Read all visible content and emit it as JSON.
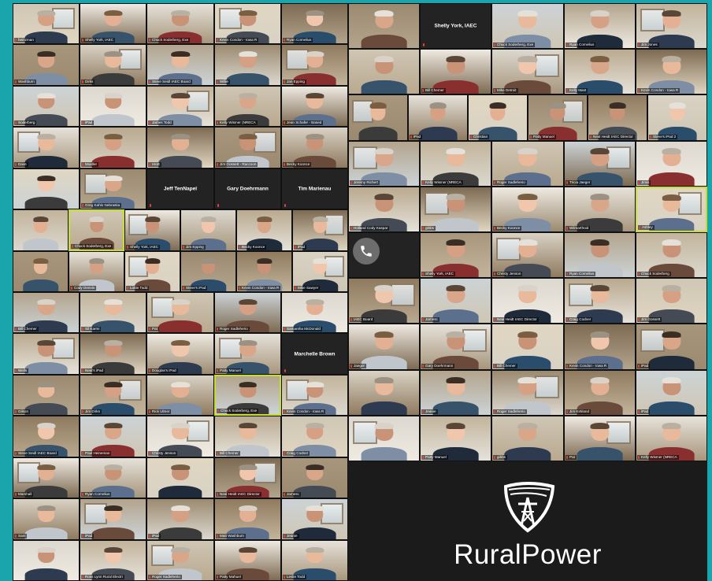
{
  "left_grid": {
    "names": [
      [
        "heinzman",
        "Shelly York, IAEC",
        "Chuck Soderberg, Exe",
        "Kevin Condon - Iowa R",
        "Ryan Cornelius"
      ],
      [
        "Washburn",
        "Dirks",
        "Steve Seidl IAEC Board",
        "Willie",
        "Jan Epping"
      ],
      [
        "Soderberg",
        "iPad",
        "James Todd",
        "Kelly Wismer (NRECA",
        "Jean Schafer - Based"
      ],
      [
        "Dave",
        "Moeller",
        "Hirdt",
        "Jim Gossett - Raccoon",
        "Becky Koonce"
      ],
      [
        "",
        "Greg Kahlo Nebraska",
        "Jeff TenNapel",
        "Gary Doehrmann",
        "Tim Marienau"
      ],
      [
        "",
        "Chuck Soderberg, Exe",
        "Shelly York, IAEC",
        "Jim Epping",
        "Becky Koonce",
        "iPad"
      ],
      [
        "",
        "Cody Dennis",
        "Lottie Todd",
        "Steve's iPad",
        "Kevin Condon - Iowa R",
        "Mike Sawyer"
      ],
      [
        "Bill Chemer",
        "Sil Karmi",
        "Pat",
        "Roger Sadleherio",
        "Samantha McDonald"
      ],
      [
        "Wells",
        "Neal's iPad",
        "Douglas's iPad",
        "Patty Manuel",
        "Marchelle Brown"
      ],
      [
        "Gilson",
        "Jim Dirks",
        "Rick Ulmer",
        "Chuck Soderberg, Exe",
        "Kevin Condon - Iowa R"
      ],
      [
        "Steve Seidl IAEC Board",
        "Paul Heineman",
        "Christy Jenson",
        "Bill Chemer",
        "Craig Codner"
      ],
      [
        "Marshall",
        "Ryan Cornelius",
        "",
        "Neal Heidt IAEC Director",
        "Jamesc"
      ],
      [
        "Sam",
        "iPad",
        "iPad",
        "Matt Washburn",
        "Jeanie"
      ],
      [
        "",
        "Ross Lynn Rural Electri",
        "Roger Sadleherio",
        "Patty Mahuel",
        "Leslie Todd"
      ]
    ],
    "text_tiles": {
      "jeff": "Jeff TenNapel",
      "gary": "Gary Doehrmann",
      "tim": "Tim Marienau",
      "marchelle": "Marchelle Brown"
    }
  },
  "right_grid": {
    "names": [
      [
        "",
        "Shelly York, IAEC",
        "Chuck Soderberg, Exe",
        "Ryan Cornelius",
        "Jim Jones"
      ],
      [
        "",
        "Bill Chemer",
        "Mike Detroit",
        "Kelly Mast",
        "Kevin Condon - Iowa R"
      ],
      [
        "",
        "iPad",
        "Christian",
        "Patty Manuel",
        "Neal Heidt IAEC Director",
        "Steve's iPad 2"
      ],
      [
        "Jeremy Richert",
        "Kelly Wismer (NRECA",
        "Roger Sadleherio",
        "Tricia Jaeger",
        "Jimis"
      ],
      [
        "Holland Cody Kaspar",
        "gibbs",
        "Becky Koonce",
        "Wilmarthoid",
        "Ashley"
      ],
      [
        "",
        "Shelly York, IAEC",
        "Christy Jenson",
        "Ryan Cornelius",
        "Chuck Soderberg"
      ],
      [
        "IAEC Board",
        "Jamesc",
        "Neal Heidt IAEC Director",
        "Craig Codner",
        "Jim Gossett"
      ],
      [
        "Jaeger",
        "Gary Doehrmann",
        "Bill Chemer",
        "Kevin Condon - Iowa R",
        "iPad"
      ],
      [
        "",
        "Jeanie",
        "Roger Sadleherio",
        "Jim Kirkland",
        "iPad"
      ],
      [
        "",
        "Patty Manuel",
        "gibbs",
        "Pat",
        "Kelly Wismer (NRECA"
      ]
    ],
    "top_label": "Shelly York, IAEC"
  },
  "branding": {
    "logo_text": "RuralPower",
    "logo_icon": "power-line-tower-icon"
  },
  "colors": {
    "frame_teal": "#1aa5ad",
    "panel_dark": "#1b1b1b",
    "active_speaker": "#c7dc2f",
    "mic_muted_red": "#e0433a"
  },
  "icons": {
    "call": "phone-icon",
    "muted": "mic-muted-icon"
  }
}
